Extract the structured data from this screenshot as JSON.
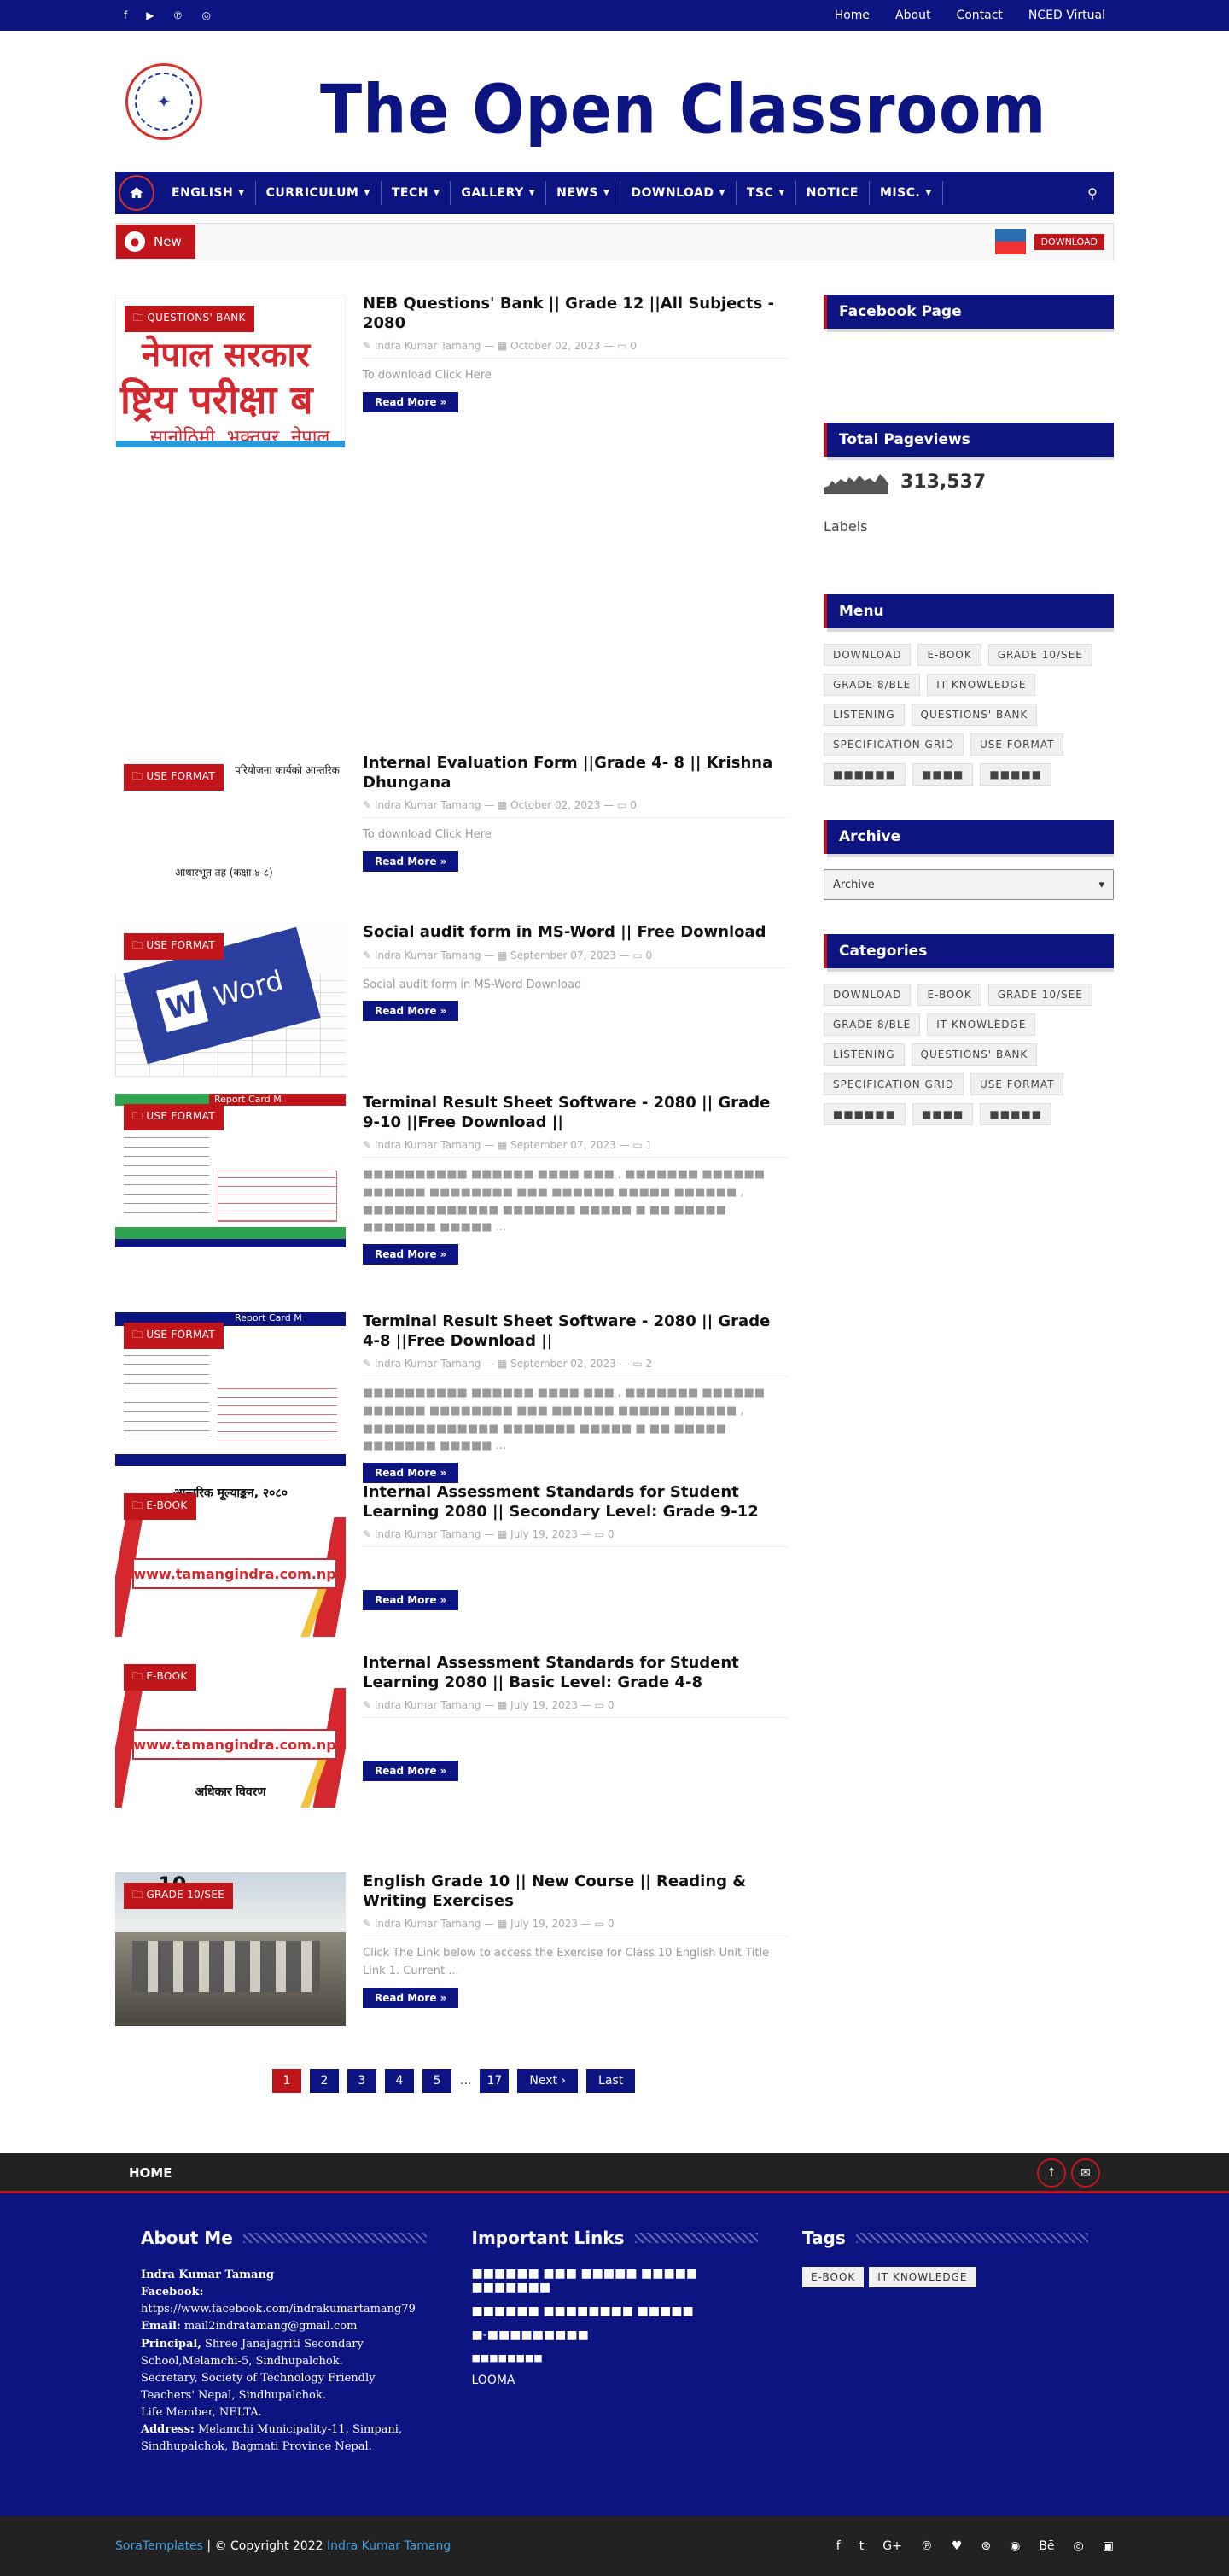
{
  "topbar": {
    "social_icons": [
      "facebook-icon",
      "youtube-icon",
      "pinterest-icon",
      "instagram-icon"
    ],
    "links": [
      "Home",
      "About",
      "Contact",
      "NCED Virtual"
    ]
  },
  "header": {
    "title": "The Open Classroom"
  },
  "nav": {
    "items": [
      {
        "label": "ENGLISH",
        "dropdown": true
      },
      {
        "label": "CURRICULUM",
        "dropdown": true
      },
      {
        "label": "TECH",
        "dropdown": true
      },
      {
        "label": "GALLERY",
        "dropdown": true
      },
      {
        "label": "NEWS",
        "dropdown": true
      },
      {
        "label": "DOWNLOAD",
        "dropdown": true
      },
      {
        "label": "TSC",
        "dropdown": true
      },
      {
        "label": "NOTICE",
        "dropdown": false
      },
      {
        "label": "MISC.",
        "dropdown": true
      }
    ]
  },
  "ticker": {
    "label": "New",
    "download": "DOWNLOAD"
  },
  "posts": [
    {
      "category": "QUESTIONS' BANK",
      "title": "NEB Questions' Bank || Grade 12 ||All Subjects - 2080",
      "author": "Indra Kumar Tamang",
      "date": "October 02, 2023",
      "comments": "0",
      "excerpt": "To download   Click Here",
      "readmore": "Read More »",
      "thumb_text": [
        "नेपाल सरकार",
        "ष्ट्रिय परीक्षा ब",
        "सानोठिमी, भक्तपुर, नेपाल"
      ]
    },
    {
      "category": "USE FORMAT",
      "title": "Internal Evaluation Form ||Grade 4- 8 || Krishna Dhungana",
      "author": "Indra Kumar Tamang",
      "date": "October 02, 2023",
      "comments": "0",
      "excerpt": "To download   Click Here",
      "readmore": "Read More »",
      "thumb_text": [
        "परियोजना कार्यको आन्तरिक",
        "आधारभूत तह (कक्षा ४-८)"
      ]
    },
    {
      "category": "USE FORMAT",
      "title": "Social audit form in MS-Word || Free Download",
      "author": "Indra Kumar Tamang",
      "date": "September 07, 2023",
      "comments": "0",
      "excerpt": " Social audit form in MS-Word   Download",
      "readmore": "Read More »",
      "thumb_text": [
        "W",
        "Word"
      ]
    },
    {
      "category": "USE FORMAT",
      "title": "Terminal Result Sheet Software - 2080 || Grade 9-10 ||Free Download ||",
      "author": "Indra Kumar Tamang",
      "date": "September 07, 2023",
      "comments": "1",
      "excerpt": "     ■■■■■■■■■■ ■■■■■■ ■■■■ ■■■ ,  ■■■■■■■ ■■■■■■ ■■■■■■ ■■■■■■■■ ■■■ ■■■■■■ ■■■■■ ■■■■■■ , ■■■■■■■■■■■■■ ■■■■■■■ ■■■■■ ■ ■■ ■■■■■ ■■■■■■■ ■■■■■ ...",
      "readmore": "Read More »",
      "thumb_text": [
        "Report Card M"
      ]
    },
    {
      "category": "USE FORMAT",
      "title": "Terminal Result Sheet Software - 2080 || Grade 4-8 ||Free Download ||",
      "author": "Indra Kumar Tamang",
      "date": "September 02, 2023",
      "comments": "2",
      "excerpt": "     ■■■■■■■■■■ ■■■■■■ ■■■■ ■■■ , ■■■■■■■ ■■■■■■ ■■■■■■ ■■■■■■■■ ■■■ ■■■■■■ ■■■■■ ■■■■■■ , ■■■■■■■■■■■■■ ■■■■■■■ ■■■■■ ■ ■■ ■■■■■ ■■■■■■■ ■■■■■ ...",
      "readmore": "Read More »",
      "thumb_text": [
        "Report Card M"
      ]
    },
    {
      "category": "E-BOOK",
      "title": "Internal Assessment Standards for Student Learning 2080 || Secondary Level: Grade 9-12",
      "author": "Indra Kumar Tamang",
      "date": "July 19, 2023",
      "comments": "0",
      "excerpt": "",
      "readmore": "Read More »",
      "thumb_text": [
        "www.tamangindra.com.np",
        "आन्तरिक मूल्याङ्कन, २०८०"
      ]
    },
    {
      "category": "E-BOOK",
      "title": "Internal Assessment Standards for Student Learning 2080 || Basic Level: Grade 4-8",
      "author": "Indra Kumar Tamang",
      "date": "July 19, 2023",
      "comments": "0",
      "excerpt": "",
      "readmore": "Read More »",
      "thumb_text": [
        "www.tamangindra.com.np",
        "अधिकार विवरण"
      ]
    },
    {
      "category": "GRADE 10/SEE",
      "title": "English Grade 10 || New Course || Reading & Writing Exercises",
      "author": "Indra Kumar Tamang",
      "date": "July 19, 2023",
      "comments": "0",
      "excerpt": "Click The Link below to access the Exercise for Class 10 English Unit Title Link 1. Current ...",
      "readmore": "Read More »",
      "thumb_text": [
        "10"
      ]
    }
  ],
  "pagination": [
    "1",
    "2",
    "3",
    "4",
    "5",
    "...",
    "17",
    "Next ›",
    "Last"
  ],
  "sidebar": {
    "facebook_title": "Facebook Page",
    "pageviews_title": "Total Pageviews",
    "pageviews": "313,537",
    "labels_title": "Labels",
    "menu_title": "Menu",
    "menu_tags": [
      "DOWNLOAD",
      "E-BOOK",
      "GRADE 10/SEE",
      "GRADE 8/BLE",
      "IT KNOWLEDGE",
      "LISTENING",
      "QUESTIONS' BANK",
      "SPECIFICATION GRID",
      "USE FORMAT",
      "■■■■■■",
      "■■■■",
      "■■■■■"
    ],
    "archive_title": "Archive",
    "archive_value": "Archive",
    "categories_title": "Categories",
    "category_tags": [
      "DOWNLOAD",
      "E-BOOK",
      "GRADE 10/SEE",
      "GRADE 8/BLE",
      "IT KNOWLEDGE",
      "LISTENING",
      "QUESTIONS' BANK",
      "SPECIFICATION GRID",
      "USE FORMAT",
      "■■■■■■",
      "■■■■",
      "■■■■■"
    ]
  },
  "footbar": {
    "home": "HOME"
  },
  "footer": {
    "about_title": "About Me",
    "about": {
      "name": "Indra Kumar Tamang",
      "facebook_label": "Facebook:",
      "facebook_url": "https://www.facebook.com/indrakumartamang79",
      "email_label": "Email:",
      "email": "mail2indratamang@gmail.com",
      "principal_label": "Principal,",
      "principal": "Shree Janajagriti Secondary School,Melamchi-5, Sindhupalchok.",
      "secretary": "Secretary, Society of Technology Friendly Teachers' Nepal, Sindhupalchok.",
      "life_member": "Life Member, NELTA.",
      "address_label": "Address:",
      "address": "Melamchi Municipality-11, Simpani, Sindhupalchok, Bagmati Province Nepal."
    },
    "links_title": "Important Links",
    "links": [
      "■■■■■■ ■■■ ■■■■■ ■■■■■ ■■■■■■■",
      "■■■■■■ ■■■■■■■■ ■■■■■",
      "■-■■■■■■■■■",
      "■■■■■■■■",
      "LOOMA"
    ],
    "tags_title": "Tags",
    "tags": [
      "E-BOOK",
      "IT KNOWLEDGE"
    ]
  },
  "copyright": {
    "brand": "SoraTemplates",
    "text": " | © Copyright 2022 ",
    "owner": "Indra Kumar Tamang"
  },
  "social_footer": [
    "facebook-icon",
    "twitter-icon",
    "google-plus-icon",
    "pinterest-icon",
    "heart-icon",
    "dribbble-icon",
    "rss-icon",
    "behance-icon",
    "instagram-icon",
    "vk-icon"
  ]
}
